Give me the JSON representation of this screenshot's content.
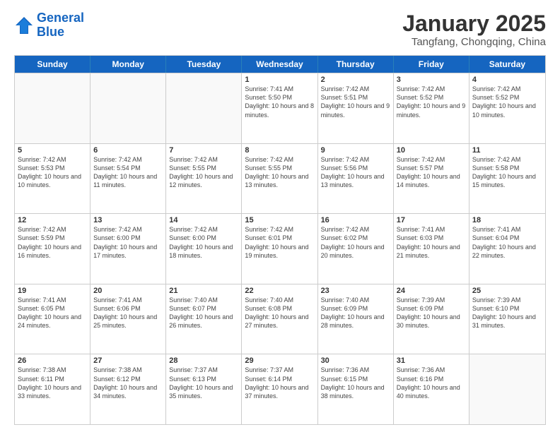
{
  "logo": {
    "line1": "General",
    "line2": "Blue"
  },
  "header": {
    "month": "January 2025",
    "location": "Tangfang, Chongqing, China"
  },
  "days": [
    "Sunday",
    "Monday",
    "Tuesday",
    "Wednesday",
    "Thursday",
    "Friday",
    "Saturday"
  ],
  "weeks": [
    [
      {
        "date": "",
        "sunrise": "",
        "sunset": "",
        "daylight": ""
      },
      {
        "date": "",
        "sunrise": "",
        "sunset": "",
        "daylight": ""
      },
      {
        "date": "",
        "sunrise": "",
        "sunset": "",
        "daylight": ""
      },
      {
        "date": "1",
        "sunrise": "Sunrise: 7:41 AM",
        "sunset": "Sunset: 5:50 PM",
        "daylight": "Daylight: 10 hours and 8 minutes."
      },
      {
        "date": "2",
        "sunrise": "Sunrise: 7:42 AM",
        "sunset": "Sunset: 5:51 PM",
        "daylight": "Daylight: 10 hours and 9 minutes."
      },
      {
        "date": "3",
        "sunrise": "Sunrise: 7:42 AM",
        "sunset": "Sunset: 5:52 PM",
        "daylight": "Daylight: 10 hours and 9 minutes."
      },
      {
        "date": "4",
        "sunrise": "Sunrise: 7:42 AM",
        "sunset": "Sunset: 5:52 PM",
        "daylight": "Daylight: 10 hours and 10 minutes."
      }
    ],
    [
      {
        "date": "5",
        "sunrise": "Sunrise: 7:42 AM",
        "sunset": "Sunset: 5:53 PM",
        "daylight": "Daylight: 10 hours and 10 minutes."
      },
      {
        "date": "6",
        "sunrise": "Sunrise: 7:42 AM",
        "sunset": "Sunset: 5:54 PM",
        "daylight": "Daylight: 10 hours and 11 minutes."
      },
      {
        "date": "7",
        "sunrise": "Sunrise: 7:42 AM",
        "sunset": "Sunset: 5:55 PM",
        "daylight": "Daylight: 10 hours and 12 minutes."
      },
      {
        "date": "8",
        "sunrise": "Sunrise: 7:42 AM",
        "sunset": "Sunset: 5:55 PM",
        "daylight": "Daylight: 10 hours and 13 minutes."
      },
      {
        "date": "9",
        "sunrise": "Sunrise: 7:42 AM",
        "sunset": "Sunset: 5:56 PM",
        "daylight": "Daylight: 10 hours and 13 minutes."
      },
      {
        "date": "10",
        "sunrise": "Sunrise: 7:42 AM",
        "sunset": "Sunset: 5:57 PM",
        "daylight": "Daylight: 10 hours and 14 minutes."
      },
      {
        "date": "11",
        "sunrise": "Sunrise: 7:42 AM",
        "sunset": "Sunset: 5:58 PM",
        "daylight": "Daylight: 10 hours and 15 minutes."
      }
    ],
    [
      {
        "date": "12",
        "sunrise": "Sunrise: 7:42 AM",
        "sunset": "Sunset: 5:59 PM",
        "daylight": "Daylight: 10 hours and 16 minutes."
      },
      {
        "date": "13",
        "sunrise": "Sunrise: 7:42 AM",
        "sunset": "Sunset: 6:00 PM",
        "daylight": "Daylight: 10 hours and 17 minutes."
      },
      {
        "date": "14",
        "sunrise": "Sunrise: 7:42 AM",
        "sunset": "Sunset: 6:00 PM",
        "daylight": "Daylight: 10 hours and 18 minutes."
      },
      {
        "date": "15",
        "sunrise": "Sunrise: 7:42 AM",
        "sunset": "Sunset: 6:01 PM",
        "daylight": "Daylight: 10 hours and 19 minutes."
      },
      {
        "date": "16",
        "sunrise": "Sunrise: 7:42 AM",
        "sunset": "Sunset: 6:02 PM",
        "daylight": "Daylight: 10 hours and 20 minutes."
      },
      {
        "date": "17",
        "sunrise": "Sunrise: 7:41 AM",
        "sunset": "Sunset: 6:03 PM",
        "daylight": "Daylight: 10 hours and 21 minutes."
      },
      {
        "date": "18",
        "sunrise": "Sunrise: 7:41 AM",
        "sunset": "Sunset: 6:04 PM",
        "daylight": "Daylight: 10 hours and 22 minutes."
      }
    ],
    [
      {
        "date": "19",
        "sunrise": "Sunrise: 7:41 AM",
        "sunset": "Sunset: 6:05 PM",
        "daylight": "Daylight: 10 hours and 24 minutes."
      },
      {
        "date": "20",
        "sunrise": "Sunrise: 7:41 AM",
        "sunset": "Sunset: 6:06 PM",
        "daylight": "Daylight: 10 hours and 25 minutes."
      },
      {
        "date": "21",
        "sunrise": "Sunrise: 7:40 AM",
        "sunset": "Sunset: 6:07 PM",
        "daylight": "Daylight: 10 hours and 26 minutes."
      },
      {
        "date": "22",
        "sunrise": "Sunrise: 7:40 AM",
        "sunset": "Sunset: 6:08 PM",
        "daylight": "Daylight: 10 hours and 27 minutes."
      },
      {
        "date": "23",
        "sunrise": "Sunrise: 7:40 AM",
        "sunset": "Sunset: 6:09 PM",
        "daylight": "Daylight: 10 hours and 28 minutes."
      },
      {
        "date": "24",
        "sunrise": "Sunrise: 7:39 AM",
        "sunset": "Sunset: 6:09 PM",
        "daylight": "Daylight: 10 hours and 30 minutes."
      },
      {
        "date": "25",
        "sunrise": "Sunrise: 7:39 AM",
        "sunset": "Sunset: 6:10 PM",
        "daylight": "Daylight: 10 hours and 31 minutes."
      }
    ],
    [
      {
        "date": "26",
        "sunrise": "Sunrise: 7:38 AM",
        "sunset": "Sunset: 6:11 PM",
        "daylight": "Daylight: 10 hours and 33 minutes."
      },
      {
        "date": "27",
        "sunrise": "Sunrise: 7:38 AM",
        "sunset": "Sunset: 6:12 PM",
        "daylight": "Daylight: 10 hours and 34 minutes."
      },
      {
        "date": "28",
        "sunrise": "Sunrise: 7:37 AM",
        "sunset": "Sunset: 6:13 PM",
        "daylight": "Daylight: 10 hours and 35 minutes."
      },
      {
        "date": "29",
        "sunrise": "Sunrise: 7:37 AM",
        "sunset": "Sunset: 6:14 PM",
        "daylight": "Daylight: 10 hours and 37 minutes."
      },
      {
        "date": "30",
        "sunrise": "Sunrise: 7:36 AM",
        "sunset": "Sunset: 6:15 PM",
        "daylight": "Daylight: 10 hours and 38 minutes."
      },
      {
        "date": "31",
        "sunrise": "Sunrise: 7:36 AM",
        "sunset": "Sunset: 6:16 PM",
        "daylight": "Daylight: 10 hours and 40 minutes."
      },
      {
        "date": "",
        "sunrise": "",
        "sunset": "",
        "daylight": ""
      }
    ]
  ]
}
